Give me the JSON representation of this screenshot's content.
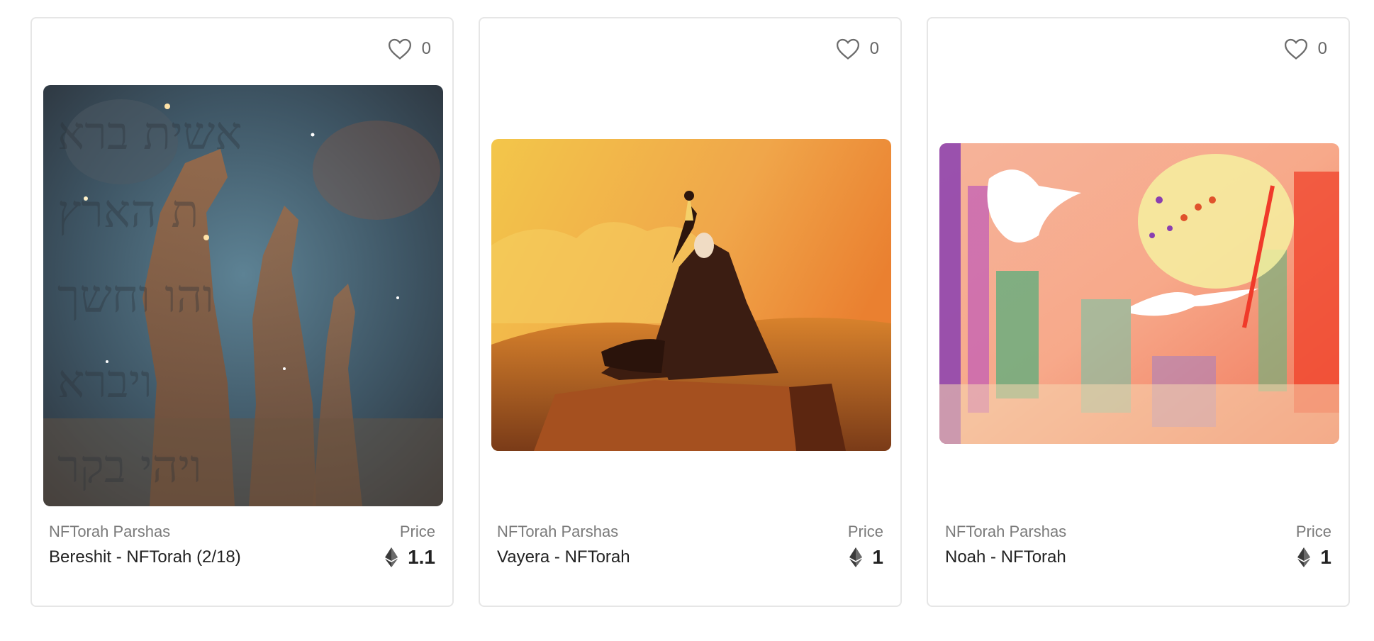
{
  "cards": [
    {
      "likes": "0",
      "collection": "NFTorah Parshas",
      "title": "Bereshit - NFTorah (2/18)",
      "price_label": "Price",
      "price": "1.1",
      "currency_icon": "ethereum-icon",
      "image": "pillars-of-creation-hebrew-text"
    },
    {
      "likes": "0",
      "collection": "NFTorah Parshas",
      "title": "Vayera - NFTorah",
      "price_label": "Price",
      "price": "1",
      "currency_icon": "ethereum-icon",
      "image": "abraham-sacrifice-sunset"
    },
    {
      "likes": "0",
      "collection": "NFTorah Parshas",
      "title": "Noah - NFTorah",
      "price_label": "Price",
      "price": "1",
      "currency_icon": "ethereum-icon",
      "image": "noah-dove-abstract"
    }
  ],
  "colors": {
    "border": "#e6e6e6",
    "text_primary": "#222222",
    "text_secondary": "#7a7a7a"
  }
}
